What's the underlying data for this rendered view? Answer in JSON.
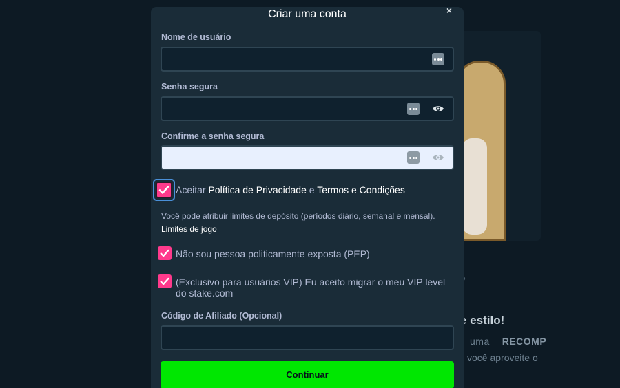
{
  "modal": {
    "title": "Criar uma conta",
    "close": "×"
  },
  "fields": {
    "username": {
      "label": "Nome de usuário",
      "value": ""
    },
    "password": {
      "label": "Senha segura",
      "value": ""
    },
    "confirm": {
      "label": "Confirme a senha segura",
      "value": ""
    },
    "affiliate": {
      "label": "Código de Afiliado (Opcional)",
      "value": ""
    }
  },
  "terms": {
    "prefix": "Aceitar",
    "privacy": "Política de Privacidade",
    "and": "e",
    "conditions": "Termos e Condições",
    "checked": true
  },
  "limits": {
    "text": "Você pode atribuir limites de depósito (períodos diário, semanal e mensal).",
    "link": "Limites de jogo"
  },
  "pep": {
    "text": "Não sou pessoa politicamente exposta (PEP)",
    "checked": true
  },
  "vip": {
    "line1": "(Exclusivo para usuários VIP) Eu aceito migrar o meu VIP level",
    "line2": "do stake.com",
    "checked": true
  },
  "submit": {
    "label": "Continuar"
  },
  "background": {
    "heading": "e estilo!",
    "line1a": "uma",
    "line1b": "RECOMP",
    "line2": "você aproveite o"
  },
  "colors": {
    "accent": "#ff3a8c",
    "primary": "#00e701",
    "modal_bg": "#1a2c38",
    "page_bg": "#0d1a24"
  }
}
